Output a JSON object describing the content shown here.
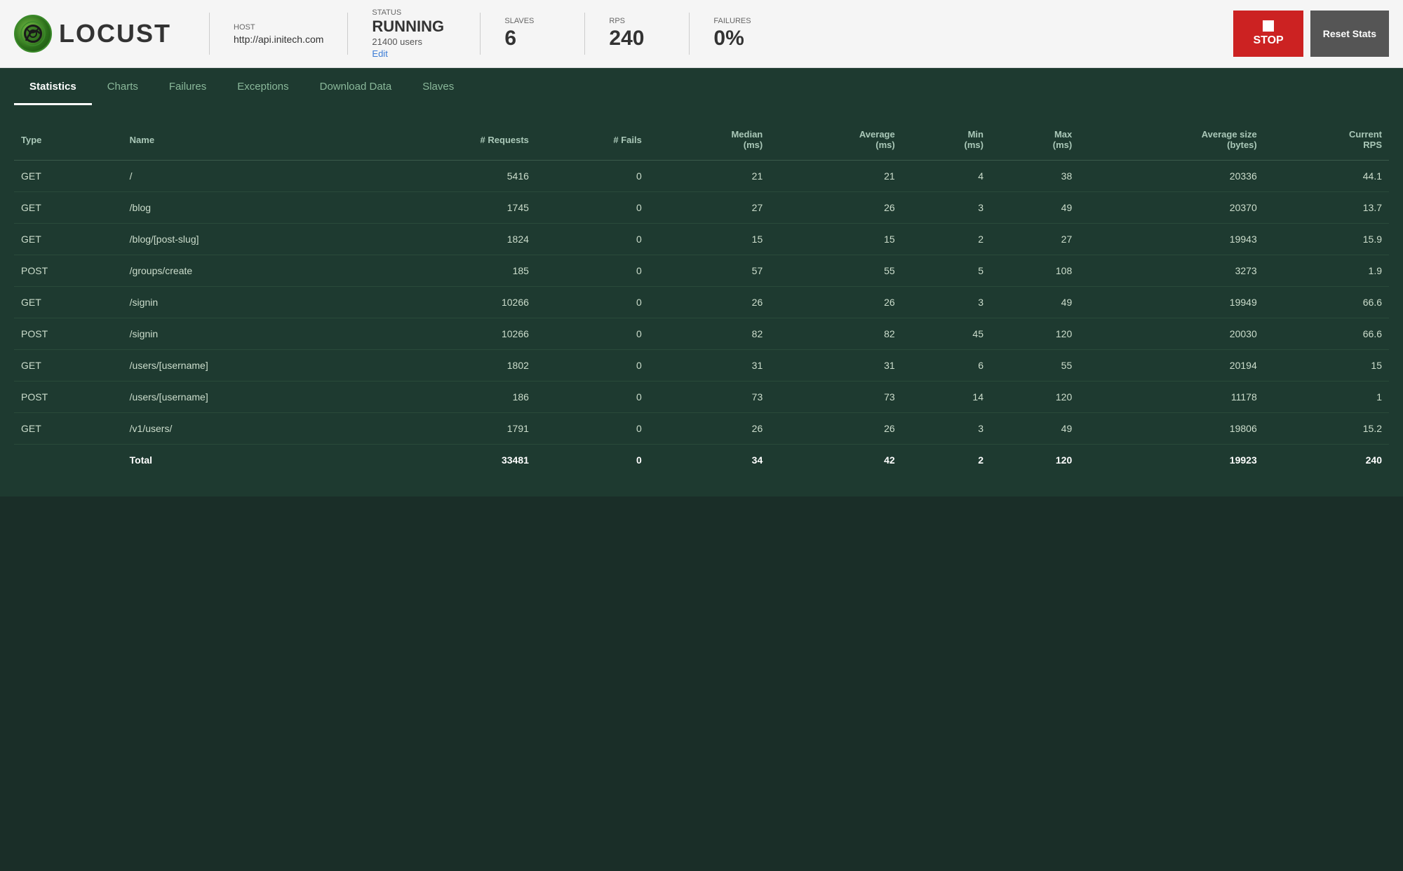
{
  "header": {
    "logo_text": "LOCUST",
    "host_label": "HOST",
    "host_value": "http://api.initech.com",
    "status_label": "STATUS",
    "status_value": "RUNNING",
    "status_users": "21400 users",
    "status_edit": "Edit",
    "slaves_label": "SLAVES",
    "slaves_value": "6",
    "rps_label": "RPS",
    "rps_value": "240",
    "failures_label": "FAILURES",
    "failures_value": "0%",
    "stop_label": "STOP",
    "reset_label": "Reset Stats"
  },
  "nav": {
    "items": [
      {
        "label": "Statistics",
        "active": true
      },
      {
        "label": "Charts",
        "active": false
      },
      {
        "label": "Failures",
        "active": false
      },
      {
        "label": "Exceptions",
        "active": false
      },
      {
        "label": "Download Data",
        "active": false
      },
      {
        "label": "Slaves",
        "active": false
      }
    ]
  },
  "table": {
    "columns": [
      "Type",
      "Name",
      "# Requests",
      "# Fails",
      "Median (ms)",
      "Average (ms)",
      "Min (ms)",
      "Max (ms)",
      "Average size (bytes)",
      "Current RPS"
    ],
    "rows": [
      {
        "type": "GET",
        "name": "/",
        "requests": "5416",
        "fails": "0",
        "median": "21",
        "average": "21",
        "min": "4",
        "max": "38",
        "avg_size": "20336",
        "rps": "44.1"
      },
      {
        "type": "GET",
        "name": "/blog",
        "requests": "1745",
        "fails": "0",
        "median": "27",
        "average": "26",
        "min": "3",
        "max": "49",
        "avg_size": "20370",
        "rps": "13.7"
      },
      {
        "type": "GET",
        "name": "/blog/[post-slug]",
        "requests": "1824",
        "fails": "0",
        "median": "15",
        "average": "15",
        "min": "2",
        "max": "27",
        "avg_size": "19943",
        "rps": "15.9"
      },
      {
        "type": "POST",
        "name": "/groups/create",
        "requests": "185",
        "fails": "0",
        "median": "57",
        "average": "55",
        "min": "5",
        "max": "108",
        "avg_size": "3273",
        "rps": "1.9"
      },
      {
        "type": "GET",
        "name": "/signin",
        "requests": "10266",
        "fails": "0",
        "median": "26",
        "average": "26",
        "min": "3",
        "max": "49",
        "avg_size": "19949",
        "rps": "66.6"
      },
      {
        "type": "POST",
        "name": "/signin",
        "requests": "10266",
        "fails": "0",
        "median": "82",
        "average": "82",
        "min": "45",
        "max": "120",
        "avg_size": "20030",
        "rps": "66.6"
      },
      {
        "type": "GET",
        "name": "/users/[username]",
        "requests": "1802",
        "fails": "0",
        "median": "31",
        "average": "31",
        "min": "6",
        "max": "55",
        "avg_size": "20194",
        "rps": "15"
      },
      {
        "type": "POST",
        "name": "/users/[username]",
        "requests": "186",
        "fails": "0",
        "median": "73",
        "average": "73",
        "min": "14",
        "max": "120",
        "avg_size": "11178",
        "rps": "1"
      },
      {
        "type": "GET",
        "name": "/v1/users/",
        "requests": "1791",
        "fails": "0",
        "median": "26",
        "average": "26",
        "min": "3",
        "max": "49",
        "avg_size": "19806",
        "rps": "15.2"
      }
    ],
    "total": {
      "label": "Total",
      "requests": "33481",
      "fails": "0",
      "median": "34",
      "average": "42",
      "min": "2",
      "max": "120",
      "avg_size": "19923",
      "rps": "240"
    }
  }
}
